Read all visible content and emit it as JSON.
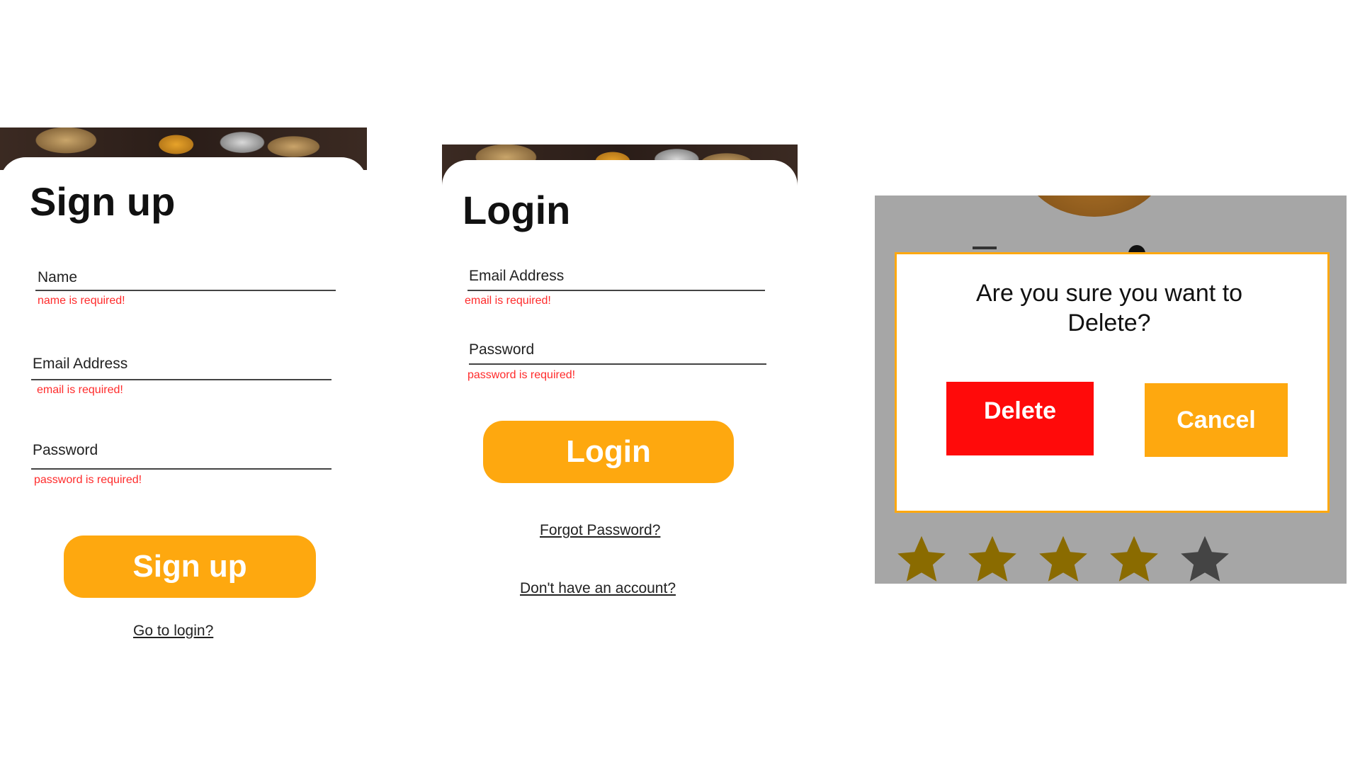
{
  "signup": {
    "title": "Sign up",
    "fields": [
      {
        "label": "Name",
        "error": "name is required!"
      },
      {
        "label": "Email Address",
        "error": "email is required!"
      },
      {
        "label": "Password",
        "error": "password is required!"
      }
    ],
    "button_label": "Sign up",
    "link_label": "Go to login?"
  },
  "login": {
    "title": "Login",
    "fields": [
      {
        "label": "Email Address",
        "error": "email is required!"
      },
      {
        "label": "Password",
        "error": "password is required!"
      }
    ],
    "button_label": "Login",
    "forgot_label": "Forgot Password?",
    "no_account_label": "Don't have an account?"
  },
  "confirm_dialog": {
    "question": "Are you sure you want to Delete?",
    "delete_label": "Delete",
    "cancel_label": "Cancel",
    "rating_value": 4,
    "rating_max": 5
  },
  "colors": {
    "accent": "#fea80f",
    "error": "#ff2b2b",
    "delete": "#ff0a0a",
    "overlay": "#a6a6a6",
    "star_filled": "#8a6b00",
    "star_empty": "#444444"
  },
  "icons": [
    "hamburger-menu-icon",
    "user-icon",
    "star-icon"
  ]
}
